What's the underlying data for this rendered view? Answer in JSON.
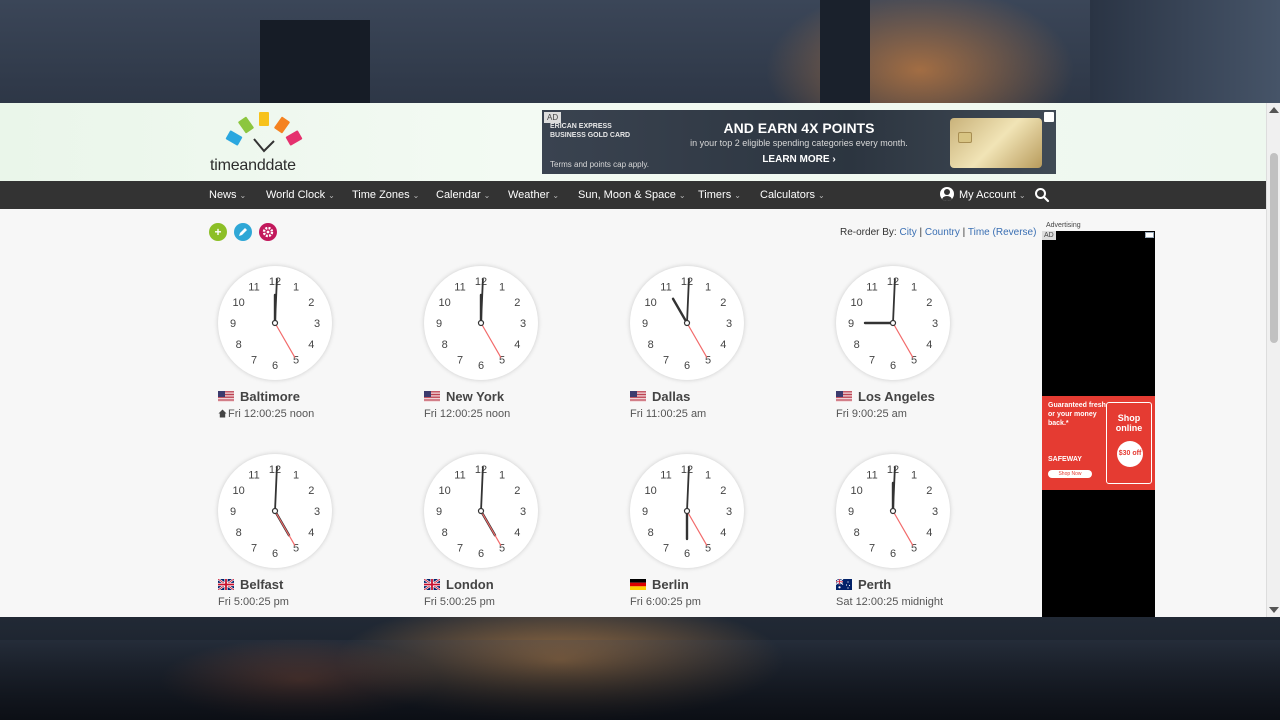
{
  "logo": {
    "text": "timeanddate"
  },
  "banner_ad": {
    "tag": "AD",
    "brand_line1": "ERICAN EXPRESS",
    "brand_line2": "BUSINESS GOLD CARD",
    "headline": "AND EARN 4X POINTS",
    "subline": "in your top 2 eligible spending categories every month.",
    "terms": "Terms and points cap apply.",
    "cta": "LEARN MORE"
  },
  "nav": {
    "items": [
      {
        "label": "News"
      },
      {
        "label": "World Clock"
      },
      {
        "label": "Time Zones"
      },
      {
        "label": "Calendar"
      },
      {
        "label": "Weather"
      },
      {
        "label": "Sun, Moon & Space"
      },
      {
        "label": "Timers"
      },
      {
        "label": "Calculators"
      }
    ],
    "account": "My Account"
  },
  "toolbar": {
    "add_symbol": "+",
    "colors": {
      "add": "#8cbf26",
      "edit": "#2fa7d6",
      "settings": "#c2185b"
    }
  },
  "reorder": {
    "label": "Re-order By:",
    "city": "City",
    "country": "Country",
    "time_reverse": "Time (Reverse)"
  },
  "clocks": [
    {
      "city": "Baltimore",
      "flag": "us",
      "time": "Fri 12:00:25 noon",
      "home": true,
      "hour": 12,
      "minute": 0,
      "second": 25
    },
    {
      "city": "New York",
      "flag": "us",
      "time": "Fri 12:00:25 noon",
      "home": false,
      "hour": 12,
      "minute": 0,
      "second": 25
    },
    {
      "city": "Dallas",
      "flag": "us",
      "time": "Fri 11:00:25 am",
      "home": false,
      "hour": 11,
      "minute": 0,
      "second": 25
    },
    {
      "city": "Los Angeles",
      "flag": "us",
      "time": "Fri 9:00:25 am",
      "home": false,
      "hour": 9,
      "minute": 0,
      "second": 25
    },
    {
      "city": "Belfast",
      "flag": "uk",
      "time": "Fri 5:00:25 pm",
      "home": false,
      "hour": 5,
      "minute": 0,
      "second": 25
    },
    {
      "city": "London",
      "flag": "uk",
      "time": "Fri 5:00:25 pm",
      "home": false,
      "hour": 5,
      "minute": 0,
      "second": 25
    },
    {
      "city": "Berlin",
      "flag": "de",
      "time": "Fri 6:00:25 pm",
      "home": false,
      "hour": 6,
      "minute": 0,
      "second": 25
    },
    {
      "city": "Perth",
      "flag": "au",
      "time": "Sat 12:00:25 midnight",
      "home": false,
      "hour": 12,
      "minute": 0,
      "second": 25
    }
  ],
  "side_ad": {
    "label": "Advertising",
    "tag": "AD",
    "guarantee": "Guaranteed fresh or your money back.*",
    "brand": "SAFEWAY",
    "shop_now": "Shop Now",
    "shop_online": "Shop online",
    "coupon": "$30 off"
  },
  "icons": {
    "add": "plus-icon",
    "edit": "pencil-icon",
    "settings": "gear-icon",
    "account": "user-icon",
    "search": "search-icon",
    "home": "home-icon"
  }
}
